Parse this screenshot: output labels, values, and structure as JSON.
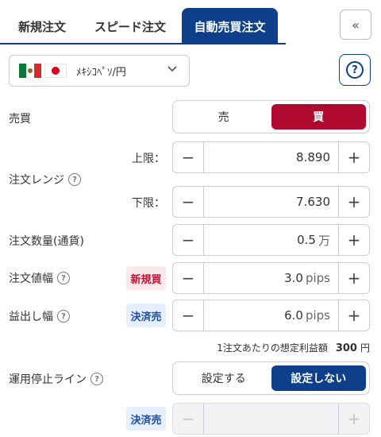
{
  "tabs": [
    {
      "label": "新規注文"
    },
    {
      "label": "スピード注文"
    },
    {
      "label": "自動売買注文"
    }
  ],
  "collapse_label": "«",
  "pair": {
    "name": "ﾒｷｼｺﾍﾟｿ/円",
    "flags": [
      "mexico-flag",
      "japan-flag"
    ]
  },
  "help_icon": "?",
  "side": {
    "label": "売買",
    "sell": "売",
    "buy": "買",
    "selected": "buy"
  },
  "range": {
    "label": "注文レンジ",
    "upper_label": "上限：",
    "upper_value": "8.890",
    "lower_label": "下限：",
    "lower_value": "7.630"
  },
  "quantity": {
    "label": "注文数量(通貨)",
    "value": "0.5",
    "unit": "万"
  },
  "order_width": {
    "label": "注文値幅",
    "badge": "新規買",
    "value": "3.0",
    "unit": "pips"
  },
  "profit_width": {
    "label": "益出し幅",
    "badge": "決済売",
    "value": "6.0",
    "unit": "pips"
  },
  "expected_profit": {
    "label": "1注文あたりの想定利益額",
    "value": "300",
    "unit": "円"
  },
  "stop_line": {
    "label": "運用停止ライン",
    "set": "設定する",
    "unset": "設定しない",
    "selected": "unset",
    "badge": "決済売"
  },
  "stepper": {
    "minus": "−",
    "plus": "+"
  },
  "colors": {
    "navy": "#0d3f8a",
    "buy_red": "#b0092f"
  }
}
